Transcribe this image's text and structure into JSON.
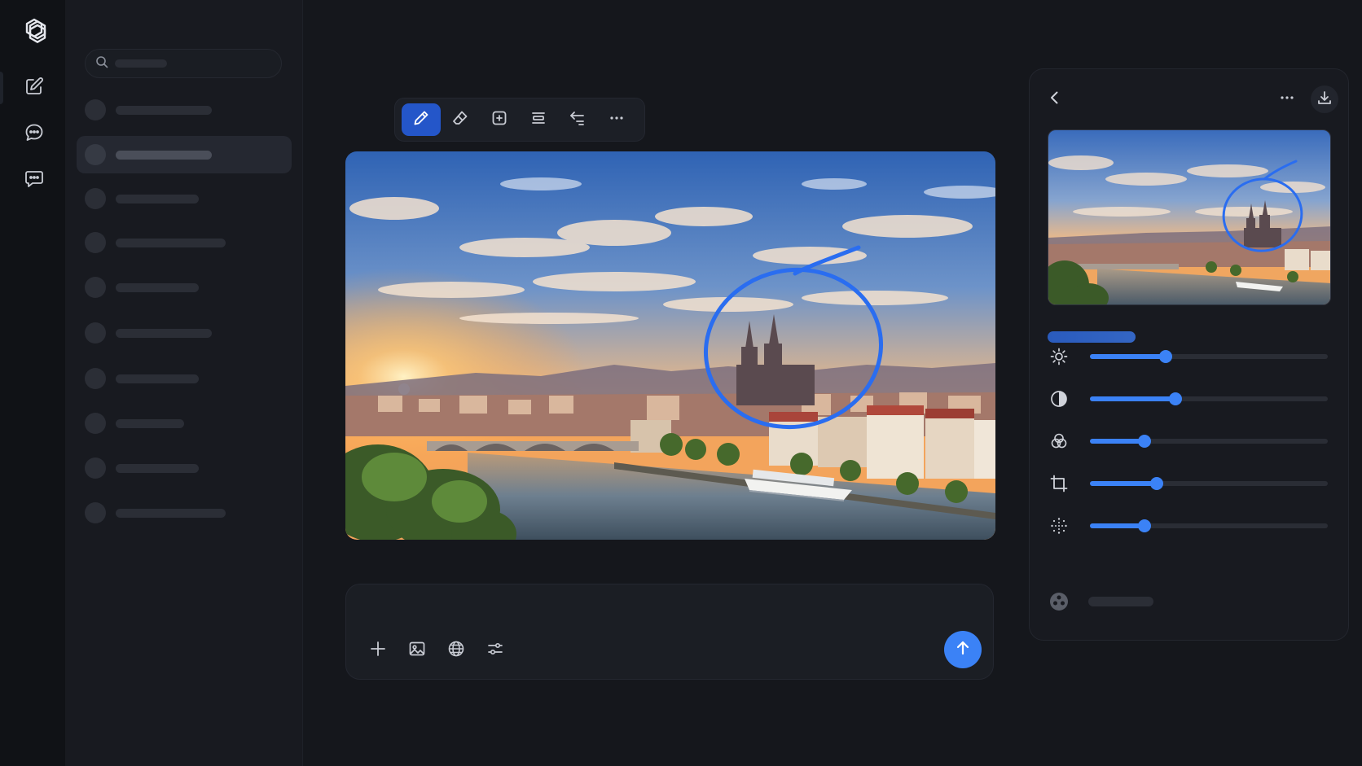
{
  "rail": {
    "items": [
      {
        "name": "compose",
        "icon": "edit-icon"
      },
      {
        "name": "chat-1",
        "icon": "chat-bubble-icon"
      },
      {
        "name": "chat-2",
        "icon": "chat-bubble-icon"
      }
    ]
  },
  "sidebar": {
    "search": {
      "icon": "search-icon",
      "placeholder": ""
    },
    "conversations_count": 10,
    "active_index": 1
  },
  "toolbar": {
    "tools": [
      "pen-icon",
      "eraser-icon",
      "add-frame-icon",
      "layers-icon",
      "undo-icon",
      "more-icon"
    ],
    "active_tool": "pen-icon"
  },
  "composer": {
    "tools": [
      "plus-icon",
      "image-icon",
      "globe-icon",
      "sliders-icon"
    ],
    "send_icon": "arrow-up-icon"
  },
  "panel": {
    "header_icons": [
      "back-icon",
      "more-icon",
      "download-icon"
    ],
    "adjustments": [
      {
        "name": "brightness",
        "icon": "sun-icon",
        "value": 0.32
      },
      {
        "name": "contrast",
        "icon": "contrast-icon",
        "value": 0.36
      },
      {
        "name": "color",
        "icon": "color-circles-icon",
        "value": 0.23
      },
      {
        "name": "crop",
        "icon": "crop-icon",
        "value": 0.28
      },
      {
        "name": "grain",
        "icon": "grain-icon",
        "value": 0.23
      }
    ],
    "footer_icon": "filter-icon"
  },
  "colors": {
    "accent": "#3b82f6",
    "active_tool": "#2456c9",
    "background": "#15171c",
    "panel": "#181a20"
  }
}
